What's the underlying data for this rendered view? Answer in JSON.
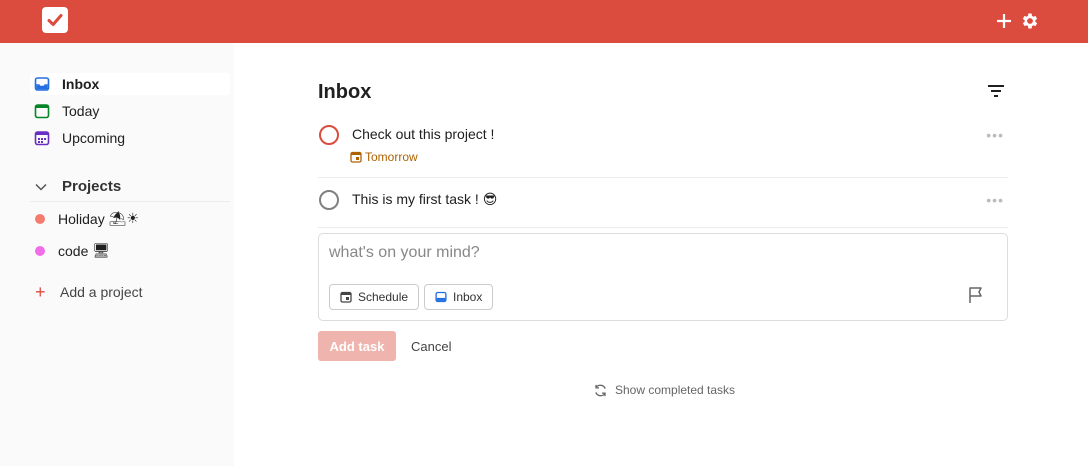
{
  "colors": {
    "brand": "#db4c3f",
    "inbox": "#246fe0",
    "today": "#058527",
    "upcoming": "#692fc2",
    "due": "#ad6200"
  },
  "nav": [
    {
      "label": "Inbox",
      "icon": "inbox-icon",
      "active": true
    },
    {
      "label": "Today",
      "icon": "calendar-today-icon"
    },
    {
      "label": "Upcoming",
      "icon": "calendar-upcoming-icon"
    }
  ],
  "projects": {
    "header": "Projects",
    "items": [
      {
        "label": "Holiday",
        "emoji": "⛱☀",
        "color": "#f47c6e"
      },
      {
        "label": "code",
        "emoji": "🖥",
        "color": "#f16ee8"
      }
    ],
    "add_label": "Add a project"
  },
  "main": {
    "title": "Inbox",
    "tasks": [
      {
        "text": "Check out this project !",
        "due": "Tomorrow",
        "priority_color": "#db4c3f"
      },
      {
        "text": "This is my first task !",
        "emoji": "😎",
        "priority_color": "#808080"
      }
    ],
    "editor": {
      "placeholder": "what's on your mind?",
      "schedule_label": "Schedule",
      "project_label": "Inbox"
    },
    "add_task_label": "Add task",
    "cancel_label": "Cancel",
    "show_completed_label": "Show completed tasks"
  }
}
